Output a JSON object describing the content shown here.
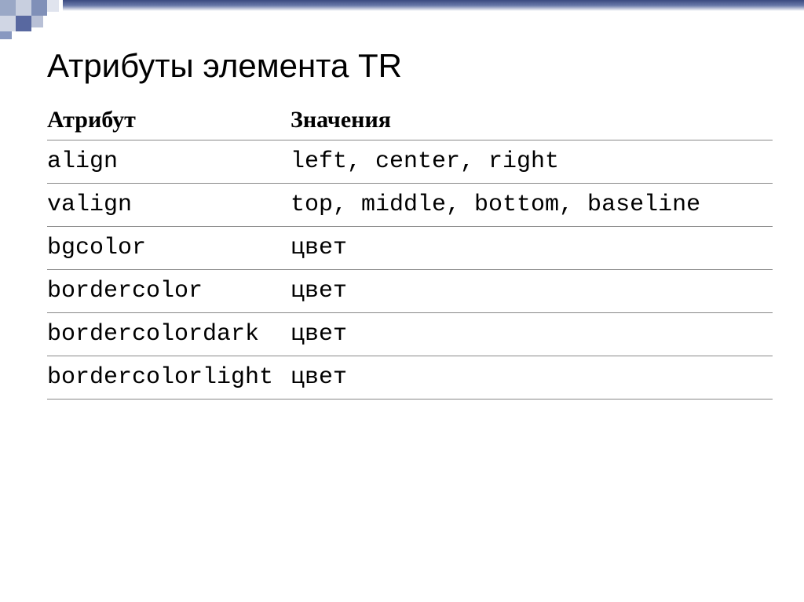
{
  "title": "Атрибуты элемента TR",
  "headers": {
    "attribute": "Атрибут",
    "values": "Значения"
  },
  "rows": [
    {
      "attr": "align",
      "val": "left, center, right"
    },
    {
      "attr": "valign",
      "val": "top, middle, bottom, baseline"
    },
    {
      "attr": "bgcolor",
      "val": "цвет"
    },
    {
      "attr": "bordercolor",
      "val": "цвет"
    },
    {
      "attr": "bordercolordark",
      "val": "цвет"
    },
    {
      "attr": "bordercolorlight",
      "val": "цвет"
    }
  ]
}
